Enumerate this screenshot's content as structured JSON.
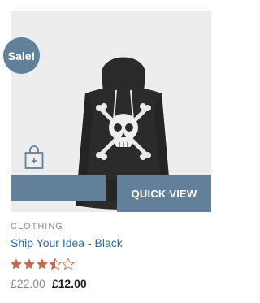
{
  "badge": {
    "label": "Sale!"
  },
  "quick_view": {
    "label": "QUICK VIEW"
  },
  "product": {
    "category": "CLOTHING",
    "title": "Ship Your Idea - Black",
    "rating": 3.5,
    "old_price": "£22.00",
    "new_price": "£12.00"
  },
  "colors": {
    "accent": "#63809b",
    "star": "#c2694f",
    "title": "#2b6aa4"
  },
  "icons": {
    "cart": "shopping-bag-icon"
  }
}
